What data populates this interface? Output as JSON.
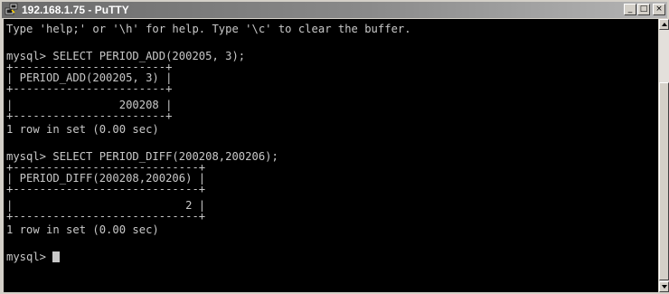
{
  "window": {
    "title": "192.168.1.75 - PuTTY",
    "controls": {
      "minimize": "_",
      "maximize": "□",
      "close": "×"
    }
  },
  "terminal": {
    "lines": [
      "Type 'help;' or '\\h' for help. Type '\\c' to clear the buffer.",
      "",
      "mysql> SELECT PERIOD_ADD(200205, 3);",
      "+-----------------------+",
      "| PERIOD_ADD(200205, 3) |",
      "+-----------------------+",
      "|                200208 |",
      "+-----------------------+",
      "1 row in set (0.00 sec)",
      "",
      "mysql> SELECT PERIOD_DIFF(200208,200206);",
      "+----------------------------+",
      "| PERIOD_DIFF(200208,200206) |",
      "+----------------------------+",
      "|                          2 |",
      "+----------------------------+",
      "1 row in set (0.00 sec)",
      "",
      "mysql> "
    ]
  },
  "colors": {
    "terminal_bg": "#000000",
    "terminal_fg": "#c8c8c8",
    "titlebar": "#7a7a7a",
    "chrome": "#d4d0c8"
  }
}
